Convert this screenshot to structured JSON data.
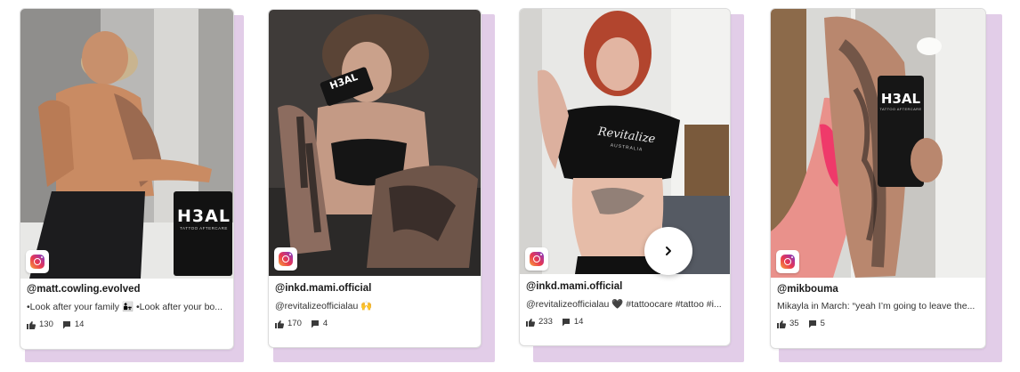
{
  "posts": [
    {
      "handle": "@matt.cowling.evolved",
      "caption": "•Look after your family 👨‍👧 •Look after your bo...",
      "likes": "130",
      "comments": "14",
      "product_label": "H3AL",
      "product_sub": "TATTOO AFTERCARE",
      "source_icon": "instagram-icon"
    },
    {
      "handle": "@inkd.mami.official",
      "caption": "@revitalizeofficialau 🙌",
      "likes": "170",
      "comments": "4",
      "product_label": "H3AL",
      "source_icon": "instagram-icon"
    },
    {
      "handle": "@inkd.mami.official",
      "caption": "@revitalizeofficialau 🖤 #tattoocare #tattoo #i...",
      "likes": "233",
      "comments": "14",
      "shirt_text": "Revitalize",
      "shirt_sub": "AUSTRALIA",
      "source_icon": "instagram-icon"
    },
    {
      "handle": "@mikbouma",
      "caption": "Mikayla in March: “yeah I’m going to leave the...",
      "likes": "35",
      "comments": "5",
      "product_label": "H3AL",
      "product_sub": "TATTOO AFTERCARE",
      "source_icon": "instagram-icon"
    }
  ],
  "icons": {
    "like": "thumbs-up-icon",
    "comment": "comment-icon",
    "next": "chevron-right-icon"
  },
  "colors": {
    "shadow": "#e2cde8",
    "card_border": "#dcdcdc"
  }
}
